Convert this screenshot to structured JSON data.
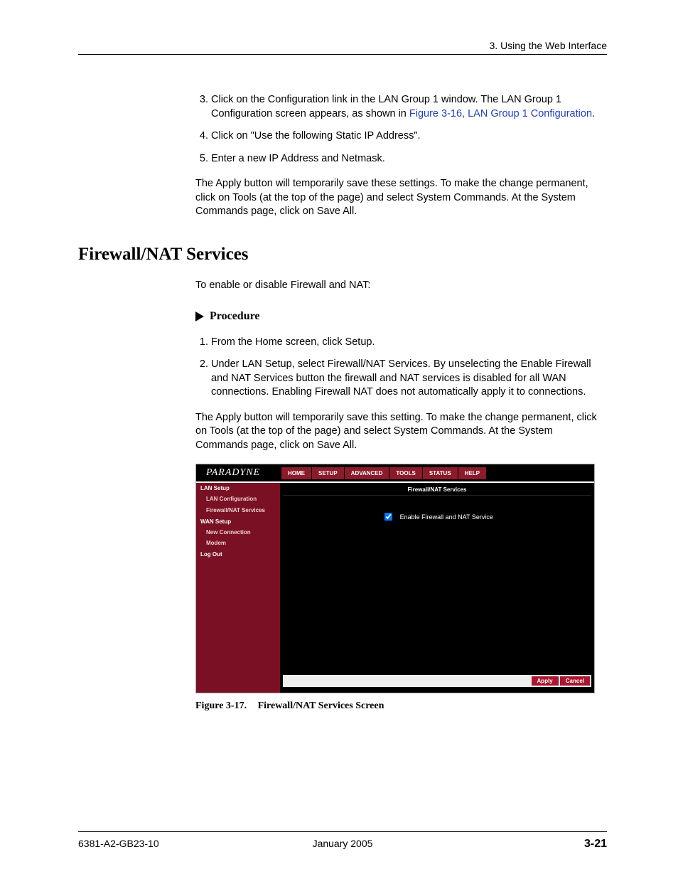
{
  "header": {
    "chapter": "3. Using the Web Interface"
  },
  "steps_a": {
    "start": 3,
    "items": [
      {
        "pre": "Click on the Configuration link in the LAN Group 1 window. The LAN Group 1 Configuration screen appears, as shown in ",
        "link": "Figure 3-16, LAN Group 1 Configuration",
        "post": "."
      },
      {
        "pre": "Click on \"Use the following Static IP Address\"."
      },
      {
        "pre": "Enter a new IP Address and Netmask."
      }
    ],
    "after": "The Apply button will temporarily save these settings. To make the change permanent, click on Tools (at the top of the page) and select System Commands. At the System Commands page, click on Save All."
  },
  "section_heading": "Firewall/NAT Services",
  "section_intro": "To enable or disable Firewall and NAT:",
  "procedure_label": "Procedure",
  "steps_b": {
    "items": [
      {
        "pre": "From the Home screen, click Setup."
      },
      {
        "pre": "Under LAN Setup, select Firewall/NAT Services. By unselecting the Enable Firewall and NAT Services button the firewall and NAT services is disabled for all WAN connections.  Enabling Firewall NAT does not automatically apply it to connections."
      }
    ],
    "after": "The Apply button will temporarily save this setting. To make the change permanent, click on Tools (at the top of the page) and select System Commands. At the System Commands page, click on Save All."
  },
  "figure": {
    "brand": "PARADYNE",
    "tabs": [
      "HOME",
      "SETUP",
      "ADVANCED",
      "TOOLS",
      "STATUS",
      "HELP"
    ],
    "sidebar": [
      {
        "type": "group",
        "label": "LAN Setup"
      },
      {
        "type": "item",
        "label": "LAN Configuration"
      },
      {
        "type": "item",
        "label": "Firewall/NAT Services"
      },
      {
        "type": "group",
        "label": "WAN Setup"
      },
      {
        "type": "item",
        "label": "New Connection"
      },
      {
        "type": "item",
        "label": "Modem"
      },
      {
        "type": "group",
        "label": "Log Out"
      }
    ],
    "panel_title": "Firewall/NAT Services",
    "checkbox_label": "Enable Firewall and NAT Service",
    "buttons": [
      "Apply",
      "Cancel"
    ],
    "caption_num": "Figure 3-17.",
    "caption_text": "Firewall/NAT Services Screen"
  },
  "footer": {
    "left": "6381-A2-GB23-10",
    "center": "January 2005",
    "right": "3-21"
  }
}
